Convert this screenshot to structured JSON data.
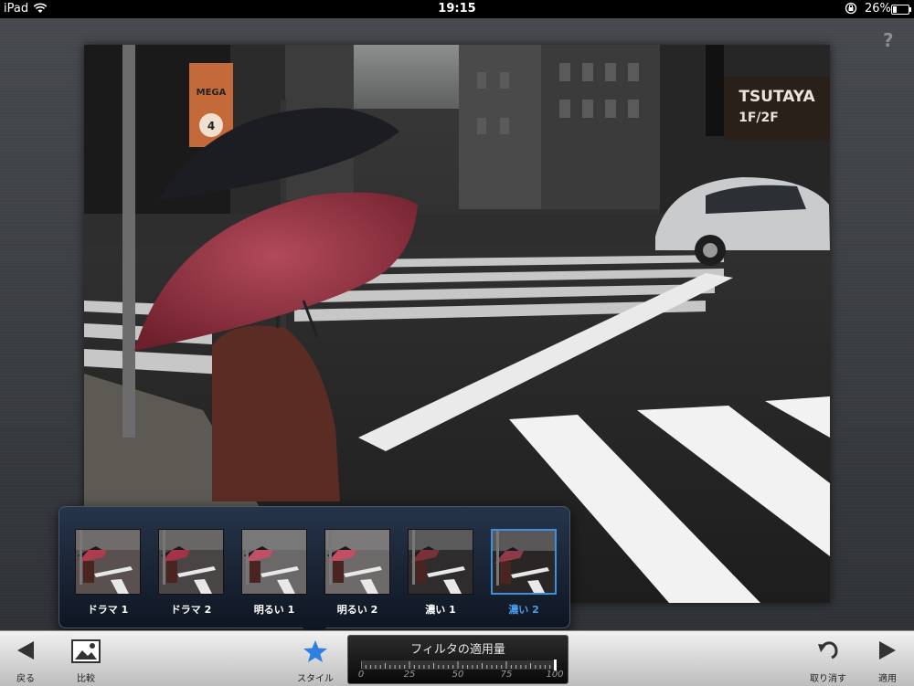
{
  "status_bar": {
    "device": "iPad",
    "time": "19:15",
    "battery": "26%",
    "battery_level": 0.26,
    "wifi_icon": "wifi-icon",
    "lock_icon": "rotation-lock-icon"
  },
  "help_label": "?",
  "photo": {
    "sign_tsutaya": "TSUTAYA",
    "sign_floor": "1F/2F",
    "sign_mega": "MEGA",
    "sign_number": "4"
  },
  "filters": {
    "selected_index": 5,
    "items": [
      {
        "label": "ドラマ 1"
      },
      {
        "label": "ドラマ 2"
      },
      {
        "label": "明るい 1"
      },
      {
        "label": "明るい 2"
      },
      {
        "label": "濃い 1"
      },
      {
        "label": "濃い 2"
      }
    ]
  },
  "toolbar": {
    "back_label": "戻る",
    "compare_label": "比較",
    "style_label": "スタイル",
    "undo_label": "取り消す",
    "apply_label": "適用",
    "accent_color": "#2f7fe0"
  },
  "slider": {
    "title": "フィルタの適用量",
    "ticks": [
      "0",
      "25",
      "50",
      "75",
      "100"
    ],
    "value": 100
  }
}
